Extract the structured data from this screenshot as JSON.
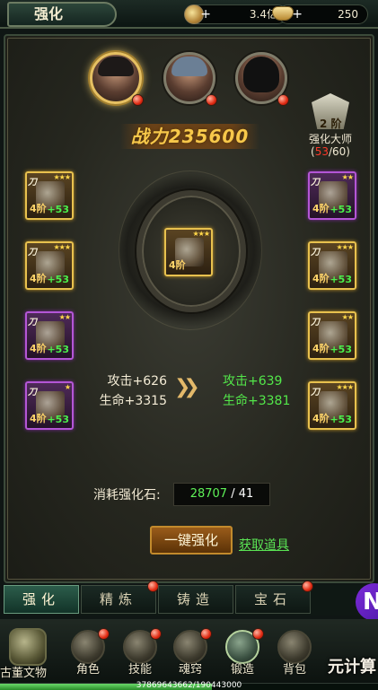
{
  "topbar": {
    "title": "强化",
    "resource1": "3.4亿",
    "resource2": "250"
  },
  "combat_power": "战力235600",
  "master": {
    "level": "2 阶",
    "name": "强化大师",
    "progress_current": "53",
    "progress_rest": "/60)",
    "progress_open": "("
  },
  "slots": {
    "stage": "4阶",
    "bonus": "+53",
    "tag": "刀"
  },
  "center": {
    "stage": "4阶"
  },
  "stats": {
    "old_attack": "攻击+626",
    "old_hp": "生命+3315",
    "new_attack": "攻击+639",
    "new_hp": "生命+3381"
  },
  "cost": {
    "label": "消耗强化石:",
    "have": "28707",
    "need": " / 41"
  },
  "buttons": {
    "one_key": "一键强化",
    "get_item": "获取道具"
  },
  "subtabs": [
    "强化",
    "精炼",
    "铸造",
    "宝石"
  ],
  "bottomnav": {
    "antique": "古董文物",
    "items": [
      "角色",
      "技能",
      "魂窍",
      "锻造",
      "背包"
    ]
  },
  "xp": {
    "text": "37869643662/190443000",
    "fraction": 0.56
  },
  "watermark": "元计算",
  "float_icon": "N"
}
